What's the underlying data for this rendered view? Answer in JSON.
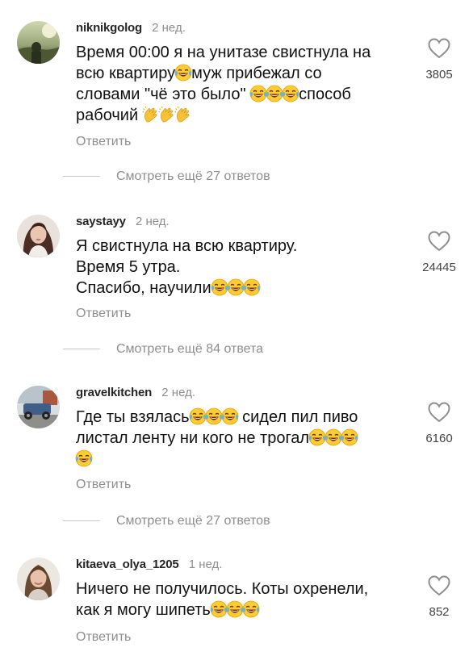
{
  "comments": [
    {
      "username": "niknikgolog",
      "time": "2 нед.",
      "lines": [
        [
          "Время 00:00 я на унитазе свистнула на"
        ],
        [
          "всю квартиру",
          "laugh",
          "муж прибежал со"
        ],
        [
          "словами \"чё это было\" ",
          "laugh",
          "laugh",
          "laugh",
          "способ"
        ],
        [
          "рабочий ",
          "clap",
          "clap",
          "clap"
        ]
      ],
      "reply_label": "Ответить",
      "likes": "3805",
      "view_replies": "Смотреть ещё 27 ответов"
    },
    {
      "username": "saystayy",
      "time": "2 нед.",
      "lines": [
        [
          "Я свистнула на всю квартиру."
        ],
        [
          "Время 5 утра."
        ],
        [
          "Спасибо, научили",
          "laugh",
          "laugh",
          "laugh"
        ]
      ],
      "reply_label": "Ответить",
      "likes": "24445",
      "view_replies": "Смотреть ещё 84 ответа"
    },
    {
      "username": "gravelkitchen",
      "time": "2 нед.",
      "lines": [
        [
          "Где ты взялась",
          "laugh",
          "laugh",
          "laugh",
          " сидел пил пиво"
        ],
        [
          "листал ленту ни кого не трогал",
          "laugh",
          "laugh",
          "laugh"
        ],
        [
          "laugh"
        ]
      ],
      "reply_label": "Ответить",
      "likes": "6160",
      "view_replies": "Смотреть ещё 27 ответов"
    },
    {
      "username": "kitaeva_olya_1205",
      "time": "1 нед.",
      "lines": [
        [
          "Ничего не получилось. Коты охренели,"
        ],
        [
          "как я могу шипеть",
          "laugh",
          "laugh",
          "laugh"
        ]
      ],
      "reply_label": "Ответить",
      "likes": "852"
    }
  ],
  "icons": {
    "like": "heart-outline-icon",
    "laugh": "face-with-tears-of-joy-emoji",
    "clap": "clapping-hands-emoji"
  },
  "colors": {
    "username": "#262626",
    "secondary": "#8e8e8e",
    "text": "#111111"
  }
}
